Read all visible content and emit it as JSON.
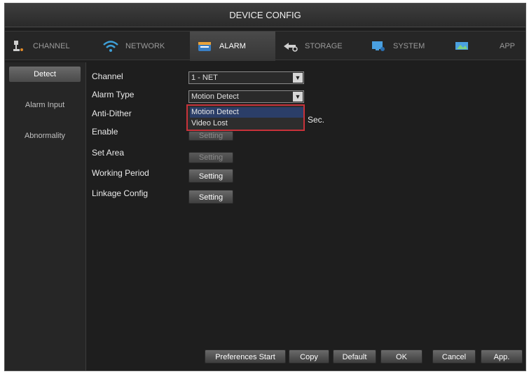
{
  "window": {
    "title": "DEVICE CONFIG"
  },
  "tabs": [
    {
      "label": "CHANNEL",
      "icon": "camera-icon"
    },
    {
      "label": "NETWORK",
      "icon": "wifi-icon"
    },
    {
      "label": "ALARM",
      "icon": "alarm-icon"
    },
    {
      "label": "STORAGE",
      "icon": "storage-icon"
    },
    {
      "label": "SYSTEM",
      "icon": "system-icon"
    },
    {
      "label": "APP",
      "icon": "app-icon"
    }
  ],
  "active_tab": "ALARM",
  "sidebar": {
    "items": [
      {
        "label": "Detect"
      },
      {
        "label": "Alarm Input"
      },
      {
        "label": "Abnormality"
      }
    ],
    "active": "Detect"
  },
  "form": {
    "channel": {
      "label": "Channel",
      "value": "1 - NET"
    },
    "alarm_type": {
      "label": "Alarm Type",
      "value": "Motion Detect",
      "options": [
        "Motion Detect",
        "Video Lost"
      ]
    },
    "anti_dither": {
      "label": "Anti-Dither",
      "unit": "Sec."
    },
    "enable": {
      "label": "Enable",
      "button": "Setting"
    },
    "set_area": {
      "label": "Set Area",
      "button": "Setting"
    },
    "working_period": {
      "label": "Working Period",
      "button": "Setting"
    },
    "linkage_config": {
      "label": "Linkage Config",
      "button": "Setting"
    }
  },
  "footer": {
    "preferences_start": "Preferences Start",
    "copy": "Copy",
    "default": "Default",
    "ok": "OK",
    "cancel": "Cancel",
    "apply": "App."
  },
  "colors": {
    "accent_red": "#c8323a",
    "highlight_blue": "#2b3e68",
    "background": "#1e1e1e"
  }
}
